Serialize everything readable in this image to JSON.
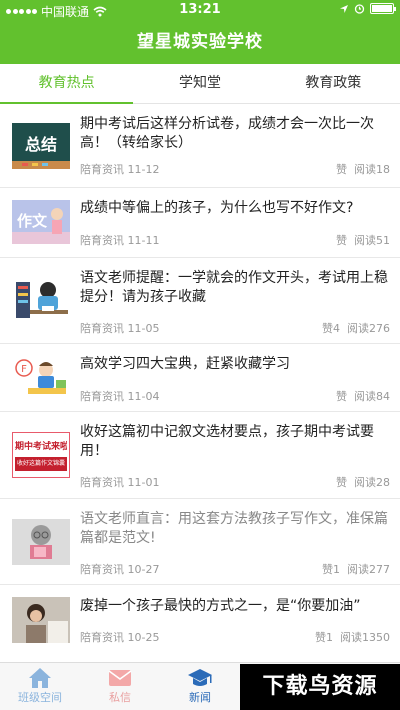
{
  "status": {
    "carrier": "中国联通",
    "time": "13:21"
  },
  "app": {
    "title": "望星城实验学校"
  },
  "tabs": [
    {
      "label": "教育热点",
      "active": true
    },
    {
      "label": "学知堂",
      "active": false
    },
    {
      "label": "教育政策",
      "active": false
    }
  ],
  "articles": [
    {
      "title": "期中考试后这样分析试卷，成绩才会一次比一次高！（转给家长）",
      "source": "陪育资讯",
      "date": "11-12",
      "likes": "赞",
      "reads": "阅读18",
      "thumb_text": "总结"
    },
    {
      "title": "成绩中等偏上的孩子，为什么也写不好作文?",
      "source": "陪育资讯",
      "date": "11-11",
      "likes": "赞",
      "reads": "阅读51",
      "thumb_text": "作文"
    },
    {
      "title": "语文老师提醒：一学就会的作文开头，考试用上稳提分！请为孩子收藏",
      "source": "陪育资讯",
      "date": "11-05",
      "likes": "赞4",
      "reads": "阅读276"
    },
    {
      "title": "高效学习四大宝典，赶紧收藏学习",
      "source": "陪育资讯",
      "date": "11-04",
      "likes": "赞",
      "reads": "阅读84"
    },
    {
      "title": "收好这篇初中记叙文选材要点，孩子期中考试要用！",
      "source": "陪育资讯",
      "date": "11-01",
      "likes": "赞",
      "reads": "阅读28",
      "thumb_text": "期中考试来啦",
      "thumb_sub": "收好这篇作文锦囊"
    },
    {
      "title": "语文老师直言：用这套方法教孩子写作文，准保篇篇都是范文!",
      "source": "陪育资讯",
      "date": "10-27",
      "likes": "赞1",
      "reads": "阅读277"
    },
    {
      "title": "废掉一个孩子最快的方式之一，是“你要加油”",
      "source": "陪育资讯",
      "date": "10-25",
      "likes": "赞1",
      "reads": "阅读1350"
    }
  ],
  "tabbar": [
    {
      "label": "班级空间",
      "icon": "home-icon"
    },
    {
      "label": "私信",
      "icon": "mail-icon"
    },
    {
      "label": "新闻",
      "icon": "graduation-cap-icon",
      "active": true
    }
  ],
  "watermark": "下载鸟资源",
  "colors": {
    "brand": "#62c12e",
    "tab_active": "#2b6bb8"
  }
}
